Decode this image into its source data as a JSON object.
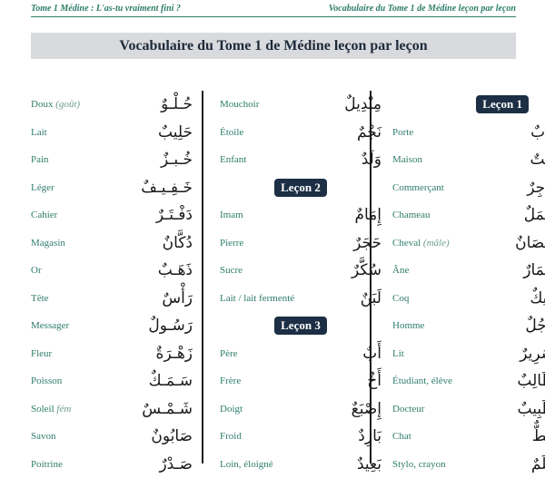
{
  "header": {
    "left": "Tome 1 Médine : L'as-tu vraiment fini ?",
    "right": "Vocabulaire du Tome 1 de Médine leçon par leçon"
  },
  "title": "Vocabulaire du Tome 1 de Médine leçon par leçon",
  "col1": [
    {
      "fr": "Doux",
      "note": "(goût)",
      "ar": "حُـلْـوٌ"
    },
    {
      "fr": "Lait",
      "note": "",
      "ar": "حَلِيبٌ"
    },
    {
      "fr": "Pain",
      "note": "",
      "ar": "خُـبـزٌ"
    },
    {
      "fr": "Léger",
      "note": "",
      "ar": "خَـفِـيـفٌ"
    },
    {
      "fr": "Cahier",
      "note": "",
      "ar": "دَفْـتَـرٌ"
    },
    {
      "fr": "Magasin",
      "note": "",
      "ar": "دُكَّانٌ"
    },
    {
      "fr": "Or",
      "note": "",
      "ar": "ذَهَـبٌ"
    },
    {
      "fr": "Tête",
      "note": "",
      "ar": "رَأْسٌ"
    },
    {
      "fr": "Messager",
      "note": "",
      "ar": "رَسُـولٌ"
    },
    {
      "fr": "Fleur",
      "note": "",
      "ar": "زَهْـرَةٌ"
    },
    {
      "fr": "Poisson",
      "note": "",
      "ar": "سَـمَـكٌ"
    },
    {
      "fr": "Soleil",
      "note": "fém",
      "ar": "شَـمْـسٌ"
    },
    {
      "fr": "Savon",
      "note": "",
      "ar": "صَابُونٌ"
    },
    {
      "fr": "Poitrine",
      "note": "",
      "ar": "صَـدْرٌ"
    }
  ],
  "col2a": [
    {
      "fr": "Mouchoir",
      "note": "",
      "ar": "مِنْدِيلٌ"
    },
    {
      "fr": "Étoile",
      "note": "",
      "ar": "نَجْمٌ"
    },
    {
      "fr": "Enfant",
      "note": "",
      "ar": "وَلَدٌ"
    }
  ],
  "lesson2": "Leçon 2",
  "col2b": [
    {
      "fr": "Imam",
      "note": "",
      "ar": "إِمَامٌ"
    },
    {
      "fr": "Pierre",
      "note": "",
      "ar": "حَجَرٌ"
    },
    {
      "fr": "Sucre",
      "note": "",
      "ar": "سُكَّرٌ"
    },
    {
      "fr": "Lait / lait fermenté",
      "note": "",
      "ar": "لَبَنٌ"
    }
  ],
  "lesson3": "Leçon 3",
  "col2c": [
    {
      "fr": "Père",
      "note": "",
      "ar": "أَبٌ"
    },
    {
      "fr": "Frère",
      "note": "",
      "ar": "أَخٌ"
    },
    {
      "fr": "Doigt",
      "note": "",
      "ar": "إِصْبَعٌ"
    },
    {
      "fr": "Froid",
      "note": "",
      "ar": "بَارِدٌ"
    },
    {
      "fr": "Loin, éloigné",
      "note": "",
      "ar": "بَعِيدٌ"
    }
  ],
  "lesson1": "Leçon 1",
  "col3": [
    {
      "fr": "Porte",
      "note": "",
      "ar": "بَابٌ"
    },
    {
      "fr": "Maison",
      "note": "",
      "ar": "بَيْتٌ"
    },
    {
      "fr": "Commerçant",
      "note": "",
      "ar": "تَاجِرٌ"
    },
    {
      "fr": "Chameau",
      "note": "",
      "ar": "جَمَلٌ"
    },
    {
      "fr": "Cheval",
      "note": "(mâle)",
      "ar": "حِصَانٌ"
    },
    {
      "fr": "Âne",
      "note": "",
      "ar": "حِمَارٌ"
    },
    {
      "fr": "Coq",
      "note": "",
      "ar": "دِيكٌ"
    },
    {
      "fr": "Homme",
      "note": "",
      "ar": "رَجُلٌ"
    },
    {
      "fr": "Lit",
      "note": "",
      "ar": "سَرِيرٌ"
    },
    {
      "fr": "Étudiant, élève",
      "note": "",
      "ar": "طَالِبٌ"
    },
    {
      "fr": "Docteur",
      "note": "",
      "ar": "طَبِيبٌ"
    },
    {
      "fr": "Chat",
      "note": "",
      "ar": "قِطٌّ"
    },
    {
      "fr": "Stylo, crayon",
      "note": "",
      "ar": "قَلَمٌ"
    }
  ]
}
